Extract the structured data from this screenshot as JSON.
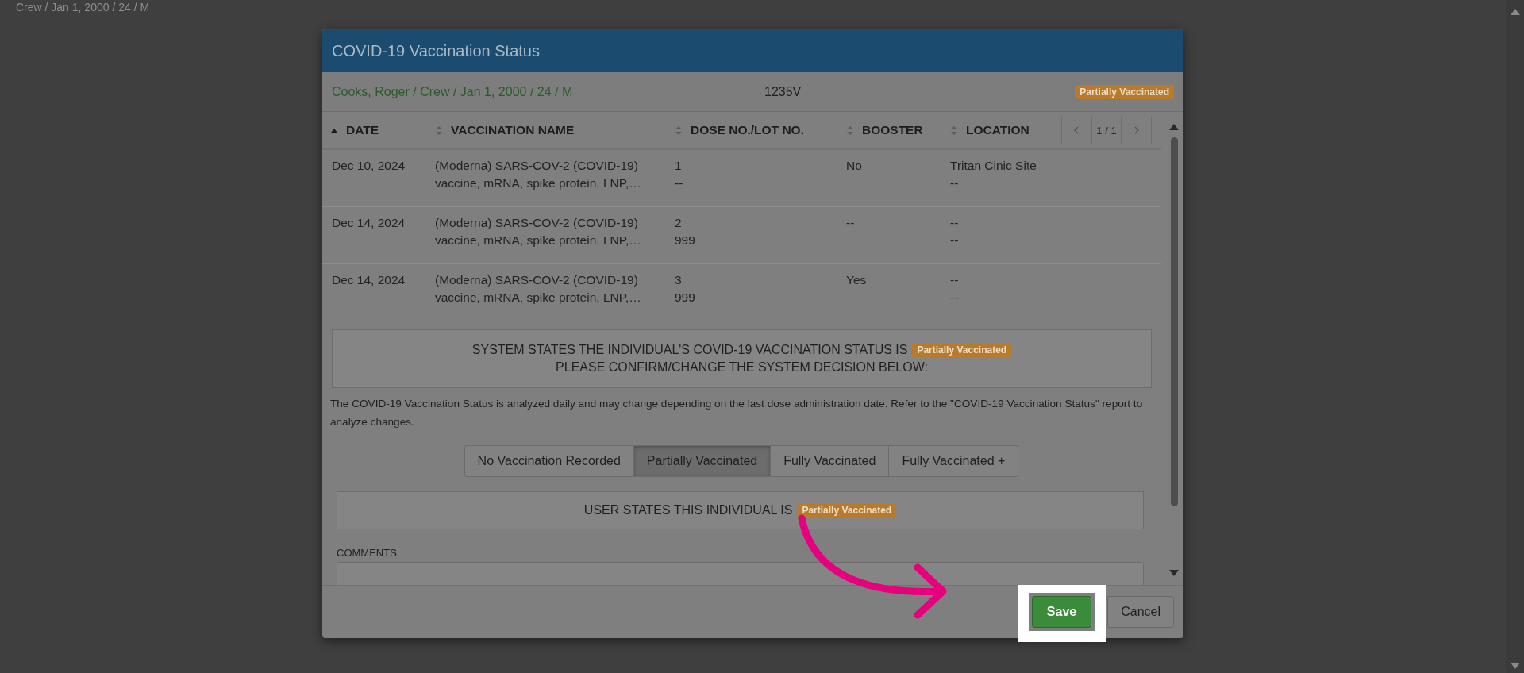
{
  "background": {
    "text": "Crew / Jan 1, 2000 / 24 / M"
  },
  "modal": {
    "title": "COVID-19 Vaccination Status",
    "patient": {
      "info": "Cooks, Roger / Crew / Jan 1, 2000 / 24 / M",
      "code": "1235V",
      "status_badge": "Partially Vaccinated"
    },
    "table": {
      "columns": [
        {
          "label": "DATE",
          "sorted": true
        },
        {
          "label": "VACCINATION NAME",
          "sorted": false
        },
        {
          "label": "DOSE NO./LOT NO.",
          "sorted": false
        },
        {
          "label": "BOOSTER",
          "sorted": false
        },
        {
          "label": "LOCATION",
          "sorted": false
        }
      ],
      "pager": {
        "page": "1 / 1"
      },
      "rows": [
        {
          "date": "Dec 10, 2024",
          "name": [
            "(Moderna) SARS-COV-2 (COVID-19)",
            "vaccine, mRNA, spike protein, LNP,…"
          ],
          "dose": [
            "1",
            "--"
          ],
          "booster": "No",
          "location": [
            "Tritan Cinic Site",
            "--"
          ]
        },
        {
          "date": "Dec 14, 2024",
          "name": [
            "(Moderna) SARS-COV-2 (COVID-19)",
            "vaccine, mRNA, spike protein, LNP,…"
          ],
          "dose": [
            "2",
            "999"
          ],
          "booster": "--",
          "location": [
            "--",
            "--"
          ]
        },
        {
          "date": "Dec 14, 2024",
          "name": [
            "(Moderna) SARS-COV-2 (COVID-19)",
            "vaccine, mRNA, spike protein, LNP,…"
          ],
          "dose": [
            "3",
            "999"
          ],
          "booster": "Yes",
          "location": [
            "--",
            "--"
          ]
        }
      ]
    },
    "system_notice": {
      "line1": "SYSTEM STATES THE INDIVIDUAL'S COVID-19 VACCINATION STATUS IS",
      "badge": "Partially Vaccinated",
      "line2": "PLEASE CONFIRM/CHANGE THE SYSTEM DECISION BELOW:"
    },
    "info_text": "The COVID-19 Vaccination Status is analyzed daily and may change depending on the last dose administration date. Refer to the \"COVID-19 Vaccination Status\" report to analyze changes.",
    "status_options": [
      {
        "label": "No Vaccination Recorded",
        "selected": false
      },
      {
        "label": "Partially Vaccinated",
        "selected": true
      },
      {
        "label": "Fully Vaccinated",
        "selected": false
      },
      {
        "label": "Fully Vaccinated +",
        "selected": false
      }
    ],
    "user_notice": {
      "text": "USER STATES THIS INDIVIDUAL IS",
      "badge": "Partially Vaccinated"
    },
    "comments": {
      "label": "COMMENTS"
    },
    "buttons": [
      {
        "label": "Save",
        "kind": "primary",
        "highlighted": true
      },
      {
        "label": "Cancel",
        "kind": "default",
        "highlighted": false
      }
    ]
  }
}
